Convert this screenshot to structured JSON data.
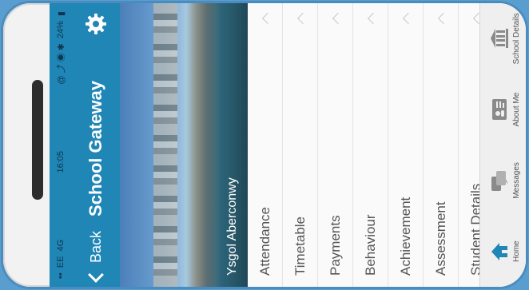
{
  "status": {
    "carrier": "EE",
    "network": "4G",
    "time": "16:05",
    "battery": "24%"
  },
  "nav": {
    "back_label": "Back",
    "title": "School Gateway"
  },
  "banner": {
    "caption": "Ysgol Aberconwy"
  },
  "menu": {
    "items": [
      {
        "label": "Attendance"
      },
      {
        "label": "Timetable"
      },
      {
        "label": "Payments"
      },
      {
        "label": "Behaviour"
      },
      {
        "label": "Achievement"
      },
      {
        "label": "Assessment"
      },
      {
        "label": "Student Details"
      }
    ]
  },
  "tabs": [
    {
      "label": "Home",
      "icon": "home-icon",
      "active": true
    },
    {
      "label": "Messages",
      "icon": "messages-icon"
    },
    {
      "label": "About Me",
      "icon": "about-me-icon"
    },
    {
      "label": "School Details",
      "icon": "school-icon"
    }
  ],
  "colors": {
    "accent": "#1f86b6",
    "active_tab": "#1f86b6",
    "inactive_tab": "#8a8a8a"
  }
}
